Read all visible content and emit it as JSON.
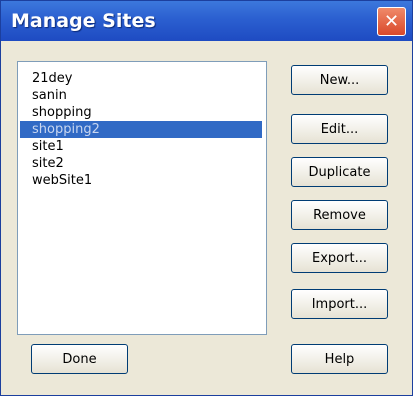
{
  "window": {
    "title": "Manage Sites",
    "close_glyph": "✕"
  },
  "sites": [
    "21dey",
    "sanin",
    "shopping",
    "shopping2",
    "site1",
    "site2",
    "webSite1"
  ],
  "selected_site": "shopping2",
  "buttons": {
    "new": "New...",
    "edit": "Edit...",
    "duplicate": "Duplicate",
    "remove": "Remove",
    "export": "Export...",
    "import": "Import...",
    "done": "Done",
    "help": "Help"
  }
}
